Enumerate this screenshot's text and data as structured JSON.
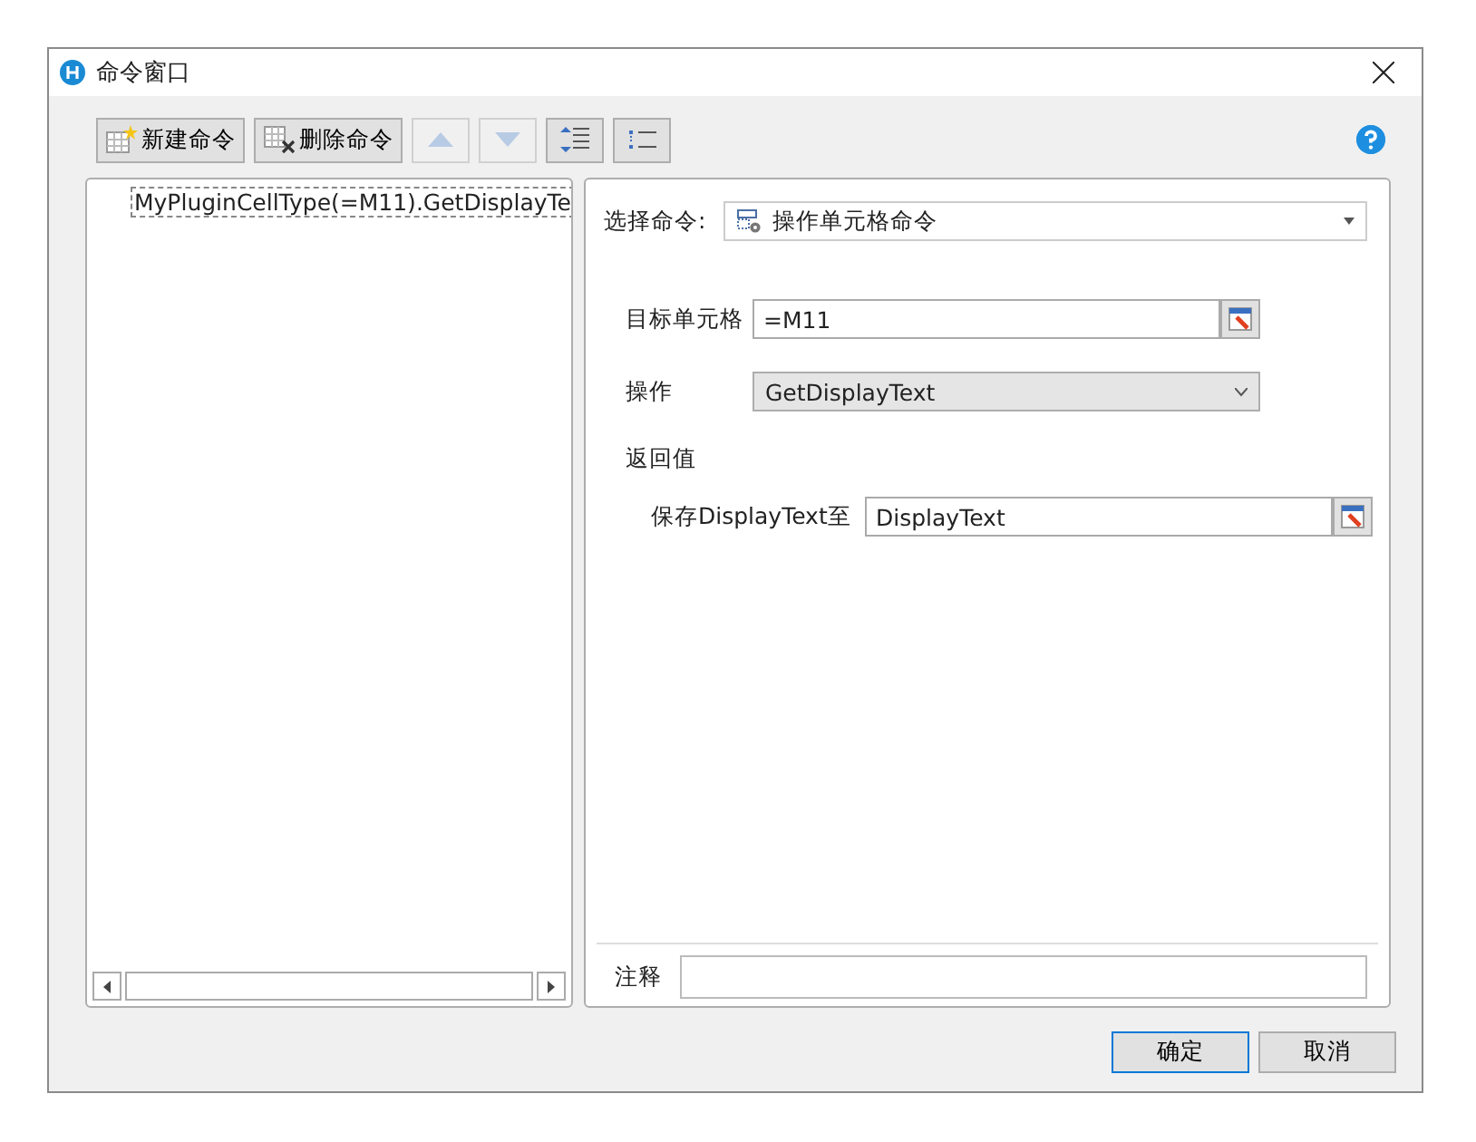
{
  "window": {
    "title": "命令窗口"
  },
  "toolbar": [
    {
      "kind": "new",
      "label": "新建命令",
      "disabled": false
    },
    {
      "kind": "delete",
      "label": "删除命令",
      "disabled": false
    },
    {
      "kind": "up",
      "disabled": true
    },
    {
      "kind": "down",
      "disabled": true
    },
    {
      "kind": "indent",
      "disabled": false
    },
    {
      "kind": "outdent",
      "disabled": false
    }
  ],
  "tree": {
    "items": [
      {
        "label": "MyPluginCellType(=M11).GetDisplayTe",
        "selected": true
      }
    ]
  },
  "command": {
    "label": "选择命令:",
    "value": "操作单元格命令"
  },
  "fields": [
    {
      "kind": "cell",
      "label": "目标单元格",
      "value": "=M11"
    },
    {
      "kind": "select",
      "label": "操作",
      "value": "GetDisplayText"
    },
    {
      "kind": "heading",
      "label": "返回值"
    },
    {
      "kind": "cell",
      "label": "保存DisplayText至",
      "value": "DisplayText",
      "indented": true
    }
  ],
  "comment": {
    "label": "注释"
  },
  "buttons": [
    {
      "label": "确定",
      "focused": true
    },
    {
      "label": "取消",
      "focused": false
    }
  ]
}
